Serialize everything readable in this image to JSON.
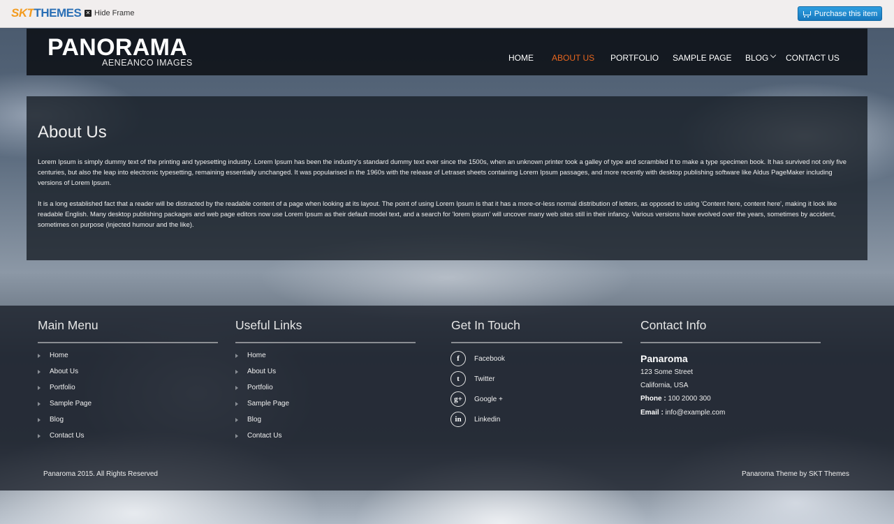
{
  "frame": {
    "logo_skt": "SKT",
    "logo_themes": "THEMES",
    "hide_frame": "Hide Frame",
    "purchase": "Purchase this item"
  },
  "header": {
    "title": "PANORAMA",
    "subtitle": "AENEANCO IMAGES",
    "nav": [
      "HOME",
      "ABOUT US",
      "PORTFOLIO",
      "SAMPLE PAGE",
      "BLOG",
      "CONTACT US"
    ],
    "active_nav": "ABOUT US"
  },
  "content": {
    "title": "About Us",
    "paragraphs": [
      "Lorem Ipsum is simply dummy text of the printing and typesetting industry. Lorem Ipsum has been the industry's standard dummy text ever since the 1500s, when an unknown printer took a galley of type and scrambled it to make a type specimen book. It has survived not only five centuries, but also the leap into electronic typesetting, remaining essentially unchanged. It was popularised in the 1960s with the release of Letraset sheets containing Lorem Ipsum passages, and more recently with desktop publishing software like Aldus PageMaker including versions of Lorem Ipsum.",
      "It is a long established fact that a reader will be distracted by the readable content of a page when looking at its layout. The point of using Lorem Ipsum is that it has a more-or-less normal distribution of letters, as opposed to using 'Content here, content here', making it look like readable English. Many desktop publishing packages and web page editors now use Lorem Ipsum as their default model text, and a search for 'lorem ipsum' will uncover many web sites still in their infancy. Various versions have evolved over the years, sometimes by accident, sometimes on purpose (injected humour and the like)."
    ]
  },
  "footer": {
    "main_menu": {
      "title": "Main Menu",
      "items": [
        "Home",
        "About Us",
        "Portfolio",
        "Sample Page",
        "Blog",
        "Contact Us"
      ]
    },
    "useful_links": {
      "title": "Useful Links",
      "items": [
        "Home",
        "About Us",
        "Portfolio",
        "Sample Page",
        "Blog",
        "Contact Us"
      ]
    },
    "get_in_touch": {
      "title": "Get In Touch",
      "items": [
        {
          "label": "Facebook",
          "icon": "facebook-icon",
          "glyph": "f"
        },
        {
          "label": "Twitter",
          "icon": "twitter-icon",
          "glyph": "t"
        },
        {
          "label": "Google +",
          "icon": "google-plus-icon",
          "glyph": "g+"
        },
        {
          "label": "Linkedin",
          "icon": "linkedin-icon",
          "glyph": "in"
        }
      ]
    },
    "contact_info": {
      "title": "Contact Info",
      "name": "Panaroma",
      "street": "123 Some Street",
      "city": "California, USA",
      "phone_label": "Phone :",
      "phone": "100 2000 300",
      "email_label": "Email :",
      "email": "info@example.com"
    },
    "copyright": "Panaroma 2015. All Rights Reserved",
    "credit": "Panaroma Theme by SKT Themes"
  },
  "colors": {
    "accent": "#e8661e",
    "purchase_button": "#1e88cf"
  }
}
